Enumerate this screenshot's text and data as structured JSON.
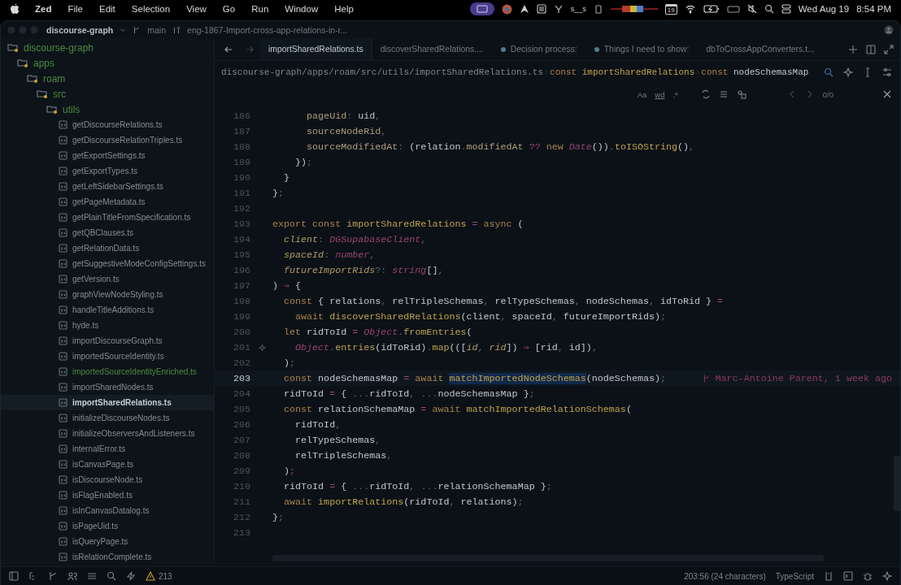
{
  "menubar": {
    "app": "Zed",
    "menus": [
      "File",
      "Edit",
      "Selection",
      "View",
      "Go",
      "Run",
      "Window",
      "Help"
    ],
    "status_text": "s__s",
    "calendar_day": "19",
    "date": "Wed Aug 19",
    "time": "8:54 PM"
  },
  "titlebar": {
    "project": "discourse-graph",
    "branch": "main",
    "pull_request": "eng-1867-Import-cross-app-relations-in-r..."
  },
  "tree": [
    {
      "label": "discourse-graph",
      "kind": "folder",
      "color": "#4e8a3e",
      "selected": false,
      "children": [
        {
          "label": "apps",
          "kind": "folder",
          "color": "#4e8a3e",
          "selected": false,
          "children": [
            {
              "label": "roam",
              "kind": "folder",
              "color": "#4e8a3e",
              "selected": false,
              "children": [
                {
                  "label": "src",
                  "kind": "folder",
                  "color": "#4e8a3e",
                  "selected": false,
                  "children": [
                    {
                      "label": "utils",
                      "kind": "folder",
                      "color": "#4e8a3e",
                      "selected": false,
                      "children": [
                        {
                          "label": "getDiscourseRelations.ts",
                          "kind": "file",
                          "color": "#858b92",
                          "selected": false
                        },
                        {
                          "label": "getDiscourseRelationTriples.ts",
                          "kind": "file",
                          "color": "#858b92",
                          "selected": false
                        },
                        {
                          "label": "getExportSettings.ts",
                          "kind": "file",
                          "color": "#858b92",
                          "selected": false
                        },
                        {
                          "label": "getExportTypes.ts",
                          "kind": "file",
                          "color": "#858b92",
                          "selected": false
                        },
                        {
                          "label": "getLeftSidebarSettings.ts",
                          "kind": "file",
                          "color": "#858b92",
                          "selected": false
                        },
                        {
                          "label": "getPageMetadata.ts",
                          "kind": "file",
                          "color": "#858b92",
                          "selected": false
                        },
                        {
                          "label": "getPlainTitleFromSpecification.ts",
                          "kind": "file",
                          "color": "#858b92",
                          "selected": false
                        },
                        {
                          "label": "getQBClauses.ts",
                          "kind": "file",
                          "color": "#858b92",
                          "selected": false
                        },
                        {
                          "label": "getRelationData.ts",
                          "kind": "file",
                          "color": "#858b92",
                          "selected": false
                        },
                        {
                          "label": "getSuggestiveModeConfigSettings.ts",
                          "kind": "file",
                          "color": "#858b92",
                          "selected": false
                        },
                        {
                          "label": "getVersion.ts",
                          "kind": "file",
                          "color": "#858b92",
                          "selected": false
                        },
                        {
                          "label": "graphViewNodeStyling.ts",
                          "kind": "file",
                          "color": "#858b92",
                          "selected": false
                        },
                        {
                          "label": "handleTitleAdditions.ts",
                          "kind": "file",
                          "color": "#858b92",
                          "selected": false
                        },
                        {
                          "label": "hyde.ts",
                          "kind": "file",
                          "color": "#858b92",
                          "selected": false
                        },
                        {
                          "label": "importDiscourseGraph.ts",
                          "kind": "file",
                          "color": "#858b92",
                          "selected": false
                        },
                        {
                          "label": "importedSourceIdentity.ts",
                          "kind": "file",
                          "color": "#858b92",
                          "selected": false
                        },
                        {
                          "label": "importedSourceIdentityEnriched.ts",
                          "kind": "file",
                          "color": "#4e8a3e",
                          "selected": false
                        },
                        {
                          "label": "importSharedNodes.ts",
                          "kind": "file",
                          "color": "#858b92",
                          "selected": false
                        },
                        {
                          "label": "importSharedRelations.ts",
                          "kind": "file",
                          "color": "#858b92",
                          "selected": true
                        },
                        {
                          "label": "initializeDiscourseNodes.ts",
                          "kind": "file",
                          "color": "#858b92",
                          "selected": false
                        },
                        {
                          "label": "initializeObserversAndListeners.ts",
                          "kind": "file",
                          "color": "#858b92",
                          "selected": false
                        },
                        {
                          "label": "internalError.ts",
                          "kind": "file",
                          "color": "#858b92",
                          "selected": false
                        },
                        {
                          "label": "isCanvasPage.ts",
                          "kind": "file",
                          "color": "#858b92",
                          "selected": false
                        },
                        {
                          "label": "isDiscourseNode.ts",
                          "kind": "file",
                          "color": "#858b92",
                          "selected": false
                        },
                        {
                          "label": "isFlagEnabled.ts",
                          "kind": "file",
                          "color": "#858b92",
                          "selected": false
                        },
                        {
                          "label": "isInCanvasDatalog.ts",
                          "kind": "file",
                          "color": "#858b92",
                          "selected": false
                        },
                        {
                          "label": "isPageUid.ts",
                          "kind": "file",
                          "color": "#858b92",
                          "selected": false
                        },
                        {
                          "label": "isQueryPage.ts",
                          "kind": "file",
                          "color": "#858b92",
                          "selected": false
                        },
                        {
                          "label": "isRelationComplete.ts",
                          "kind": "file",
                          "color": "#858b92",
                          "selected": false
                        }
                      ]
                    }
                  ]
                }
              ]
            }
          ]
        }
      ]
    }
  ],
  "tabs": [
    {
      "label": "importSharedRelations.ts",
      "kind": "file",
      "selected": true
    },
    {
      "label": "discoverSharedRelations....",
      "kind": "file",
      "selected": false
    },
    {
      "label": "Decision process:",
      "kind": "note",
      "selected": false
    },
    {
      "label": "Things I need to show:",
      "kind": "note",
      "selected": false
    },
    {
      "label": "dbToCrossAppConverters.t...",
      "kind": "file",
      "selected": false
    }
  ],
  "breadcrumb": [
    {
      "kind": "path",
      "text": "discourse-graph/apps/roam/src/utils/importSharedRelations.ts"
    },
    {
      "kind": "keyword",
      "text": "const"
    },
    {
      "kind": "symbol",
      "text": "importSharedRelations"
    },
    {
      "kind": "keyword",
      "text": "const"
    },
    {
      "kind": "current",
      "text": "nodeSchemasMap"
    }
  ],
  "search": {
    "case": "Aa",
    "word": "wd",
    "regex": ".*",
    "count": "0/0"
  },
  "code": [
    {
      "number": "186",
      "current": false,
      "hint": false,
      "tokens": [
        {
          "kind": "property",
          "text": "      pageUid"
        },
        {
          "kind": "punct",
          "text": ": "
        },
        {
          "kind": "variable",
          "text": "uid"
        },
        {
          "kind": "punct",
          "text": ","
        }
      ]
    },
    {
      "number": "187",
      "current": false,
      "hint": false,
      "tokens": [
        {
          "kind": "property",
          "text": "      sourceNodeRid"
        },
        {
          "kind": "punct",
          "text": ","
        }
      ]
    },
    {
      "number": "188",
      "current": false,
      "hint": false,
      "tokens": [
        {
          "kind": "property",
          "text": "      sourceModifiedAt"
        },
        {
          "kind": "punct",
          "text": ": "
        },
        {
          "kind": "variable",
          "text": "(relation"
        },
        {
          "kind": "punct",
          "text": "."
        },
        {
          "kind": "property",
          "text": "modifiedAt"
        },
        {
          "kind": "operator",
          "text": " ?? "
        },
        {
          "kind": "keyword",
          "text": "new "
        },
        {
          "kind": "type",
          "text": "Date"
        },
        {
          "kind": "variable",
          "text": "())"
        },
        {
          "kind": "punct",
          "text": "."
        },
        {
          "kind": "function",
          "text": "toISOString"
        },
        {
          "kind": "variable",
          "text": "()"
        },
        {
          "kind": "punct",
          "text": ","
        }
      ]
    },
    {
      "number": "189",
      "current": false,
      "hint": false,
      "tokens": [
        {
          "kind": "variable",
          "text": "    })"
        },
        {
          "kind": "punct",
          "text": ";"
        }
      ]
    },
    {
      "number": "190",
      "current": false,
      "hint": false,
      "tokens": [
        {
          "kind": "variable",
          "text": "  }"
        }
      ]
    },
    {
      "number": "191",
      "current": false,
      "hint": false,
      "tokens": [
        {
          "kind": "variable",
          "text": "}"
        },
        {
          "kind": "punct",
          "text": ";"
        }
      ]
    },
    {
      "number": "192",
      "current": false,
      "hint": false
    },
    {
      "number": "193",
      "current": false,
      "hint": false,
      "tokens": [
        {
          "kind": "keyword",
          "text": "export const "
        },
        {
          "kind": "function",
          "text": "importSharedRelations"
        },
        {
          "kind": "operator",
          "text": " = "
        },
        {
          "kind": "keyword",
          "text": "async"
        },
        {
          "kind": "variable",
          "text": " ("
        }
      ]
    },
    {
      "number": "194",
      "current": false,
      "hint": false,
      "tokens": [
        {
          "kind": "param",
          "text": "  client"
        },
        {
          "kind": "punct",
          "text": ": "
        },
        {
          "kind": "type",
          "text": "DGSupabaseClient"
        },
        {
          "kind": "punct",
          "text": ","
        }
      ]
    },
    {
      "number": "195",
      "current": false,
      "hint": false,
      "tokens": [
        {
          "kind": "param",
          "text": "  spaceId"
        },
        {
          "kind": "punct",
          "text": ": "
        },
        {
          "kind": "type",
          "text": "number"
        },
        {
          "kind": "punct",
          "text": ","
        }
      ]
    },
    {
      "number": "196",
      "current": false,
      "hint": false,
      "tokens": [
        {
          "kind": "param",
          "text": "  futureImportRids"
        },
        {
          "kind": "punct",
          "text": "?: "
        },
        {
          "kind": "type",
          "text": "string"
        },
        {
          "kind": "variable",
          "text": "[]"
        },
        {
          "kind": "punct",
          "text": ","
        }
      ]
    },
    {
      "number": "197",
      "current": false,
      "hint": false,
      "tokens": [
        {
          "kind": "variable",
          "text": ") "
        },
        {
          "kind": "operator",
          "text": "⇒"
        },
        {
          "kind": "variable",
          "text": " {"
        }
      ]
    },
    {
      "number": "198",
      "current": false,
      "hint": false,
      "tokens": [
        {
          "kind": "keyword",
          "text": "  const "
        },
        {
          "kind": "variable",
          "text": "{ relations"
        },
        {
          "kind": "punct",
          "text": ", "
        },
        {
          "kind": "variable",
          "text": "relTripleSchemas"
        },
        {
          "kind": "punct",
          "text": ", "
        },
        {
          "kind": "variable",
          "text": "relTypeSchemas"
        },
        {
          "kind": "punct",
          "text": ", "
        },
        {
          "kind": "variable",
          "text": "nodeSchemas"
        },
        {
          "kind": "punct",
          "text": ", "
        },
        {
          "kind": "variable",
          "text": "idToRid } "
        },
        {
          "kind": "operator",
          "text": "="
        }
      ]
    },
    {
      "number": "199",
      "current": false,
      "hint": false,
      "tokens": [
        {
          "kind": "keyword",
          "text": "    await "
        },
        {
          "kind": "function",
          "text": "discoverSharedRelations"
        },
        {
          "kind": "variable",
          "text": "(client"
        },
        {
          "kind": "punct",
          "text": ", "
        },
        {
          "kind": "variable",
          "text": "spaceId"
        },
        {
          "kind": "punct",
          "text": ", "
        },
        {
          "kind": "variable",
          "text": "futureImportRids)"
        },
        {
          "kind": "punct",
          "text": ";"
        }
      ]
    },
    {
      "number": "200",
      "current": false,
      "hint": false,
      "tokens": [
        {
          "kind": "keyword",
          "text": "  let "
        },
        {
          "kind": "variable",
          "text": "ridToId"
        },
        {
          "kind": "operator",
          "text": " = "
        },
        {
          "kind": "type",
          "text": "Object"
        },
        {
          "kind": "punct",
          "text": "."
        },
        {
          "kind": "function",
          "text": "fromEntries"
        },
        {
          "kind": "variable",
          "text": "("
        }
      ]
    },
    {
      "number": "201",
      "current": false,
      "hint": true,
      "tokens": [
        {
          "kind": "type",
          "text": "    Object"
        },
        {
          "kind": "punct",
          "text": "."
        },
        {
          "kind": "function",
          "text": "entries"
        },
        {
          "kind": "variable",
          "text": "(idToRid)"
        },
        {
          "kind": "punct",
          "text": "."
        },
        {
          "kind": "function",
          "text": "map"
        },
        {
          "kind": "variable",
          "text": "((["
        },
        {
          "kind": "param",
          "text": "id"
        },
        {
          "kind": "punct",
          "text": ", "
        },
        {
          "kind": "param",
          "text": "rid"
        },
        {
          "kind": "variable",
          "text": "]) "
        },
        {
          "kind": "operator",
          "text": "⇒"
        },
        {
          "kind": "variable",
          "text": " [rid"
        },
        {
          "kind": "punct",
          "text": ", "
        },
        {
          "kind": "variable",
          "text": "id])"
        },
        {
          "kind": "punct",
          "text": ","
        }
      ]
    },
    {
      "number": "202",
      "current": false,
      "hint": false,
      "tokens": [
        {
          "kind": "variable",
          "text": "  )"
        },
        {
          "kind": "punct",
          "text": ";"
        }
      ]
    },
    {
      "number": "203",
      "current": true,
      "hint": false,
      "blame": "Marc-Antoine Parent, 1 week ago",
      "tokens": [
        {
          "kind": "keyword",
          "text": "  const "
        },
        {
          "kind": "variable",
          "text": "nodeSchemasMap"
        },
        {
          "kind": "operator",
          "text": " = "
        },
        {
          "kind": "keyword",
          "text": "await "
        },
        {
          "kind": "function",
          "text": "matchImportedNodeSchemas",
          "highlighted": true
        },
        {
          "kind": "variable",
          "text": "(nodeSchemas)"
        },
        {
          "kind": "punct",
          "text": ";"
        }
      ]
    },
    {
      "number": "204",
      "current": false,
      "hint": false,
      "tokens": [
        {
          "kind": "variable",
          "text": "  ridToId"
        },
        {
          "kind": "operator",
          "text": " = "
        },
        {
          "kind": "variable",
          "text": "{ "
        },
        {
          "kind": "punct",
          "text": "..."
        },
        {
          "kind": "variable",
          "text": "ridToId"
        },
        {
          "kind": "punct",
          "text": ", ..."
        },
        {
          "kind": "variable",
          "text": "nodeSchemasMap }"
        },
        {
          "kind": "punct",
          "text": ";"
        }
      ]
    },
    {
      "number": "205",
      "current": false,
      "hint": false,
      "tokens": [
        {
          "kind": "keyword",
          "text": "  const "
        },
        {
          "kind": "variable",
          "text": "relationSchemaMap"
        },
        {
          "kind": "operator",
          "text": " = "
        },
        {
          "kind": "keyword",
          "text": "await "
        },
        {
          "kind": "function",
          "text": "matchImportedRelationSchemas"
        },
        {
          "kind": "variable",
          "text": "("
        }
      ]
    },
    {
      "number": "206",
      "current": false,
      "hint": false,
      "tokens": [
        {
          "kind": "variable",
          "text": "    ridToId"
        },
        {
          "kind": "punct",
          "text": ","
        }
      ]
    },
    {
      "number": "207",
      "current": false,
      "hint": false,
      "tokens": [
        {
          "kind": "variable",
          "text": "    relTypeSchemas"
        },
        {
          "kind": "punct",
          "text": ","
        }
      ]
    },
    {
      "number": "208",
      "current": false,
      "hint": false,
      "tokens": [
        {
          "kind": "variable",
          "text": "    relTripleSchemas"
        },
        {
          "kind": "punct",
          "text": ","
        }
      ]
    },
    {
      "number": "209",
      "current": false,
      "hint": false,
      "tokens": [
        {
          "kind": "variable",
          "text": "  )"
        },
        {
          "kind": "operator",
          "text": ";"
        }
      ]
    },
    {
      "number": "210",
      "current": false,
      "hint": false,
      "tokens": [
        {
          "kind": "variable",
          "text": "  ridToId"
        },
        {
          "kind": "operator",
          "text": " = "
        },
        {
          "kind": "variable",
          "text": "{ "
        },
        {
          "kind": "punct",
          "text": "..."
        },
        {
          "kind": "variable",
          "text": "ridToId"
        },
        {
          "kind": "punct",
          "text": ", ..."
        },
        {
          "kind": "variable",
          "text": "relationSchemaMap }"
        },
        {
          "kind": "punct",
          "text": ";"
        }
      ]
    },
    {
      "number": "211",
      "current": false,
      "hint": false,
      "tokens": [
        {
          "kind": "keyword",
          "text": "  await "
        },
        {
          "kind": "function",
          "text": "importRelations"
        },
        {
          "kind": "variable",
          "text": "(ridToId"
        },
        {
          "kind": "punct",
          "text": ", "
        },
        {
          "kind": "variable",
          "text": "relations)"
        },
        {
          "kind": "punct",
          "text": ";"
        }
      ]
    },
    {
      "number": "212",
      "current": false,
      "hint": false,
      "tokens": [
        {
          "kind": "variable",
          "text": "}"
        },
        {
          "kind": "punct",
          "text": ";"
        }
      ]
    },
    {
      "number": "213",
      "current": false,
      "hint": false
    }
  ],
  "status_bar": {
    "warnings": "213",
    "position": "203:56 (24 characters)",
    "language": "TypeScript"
  }
}
